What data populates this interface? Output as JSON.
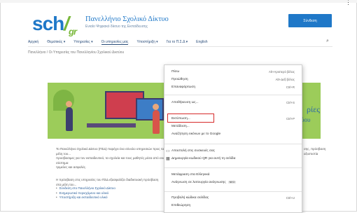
{
  "header": {
    "logo_main": "sch",
    "logo_slash": "/",
    "logo_gr": "gr",
    "title": "Πανελλήνιο Σχολικό Δίκτυο",
    "subtitle": "Ενιαίο Ψηφιακό δίκτυο της Εκπαίδευσης",
    "button_label": "Σύνδεση",
    "more_icon": "⋮"
  },
  "nav": {
    "items": [
      "Αρχική",
      "Θεματικές ▾",
      "Υπηρεσίες ▾",
      "Οι υπηρεσίες μας",
      "Υποστήριξη ▾",
      "Για το Π.Σ.Δ ▾",
      "English"
    ],
    "search_icon": "⌕"
  },
  "breadcrumb": "Πανελλήνιο / Οι Υπηρεσίες του Πανελληνίου Σχολικού Δικτύου",
  "hero": {
    "text_line1": "ρίες",
    "text_line2": "ύου"
  },
  "content": {
    "para1_line1": "Το Πανελλήνιο Σχολικό Δίκτυο (ΠΣΔ) παρέχει ένα σύνολο υπηρεσιών προς τα μέλη του...",
    "para1_line2": "προσβασιμες για τον εκπαιδευτικό, τα σχολεία και τους μαθητές μέσα από ενιαίο σύστημα",
    "para1_line3": "τριμελες και ασφαλές.",
    "para1_right1": "σης, πρόσβαση",
    "para1_right2": "αξιοπιστία",
    "para2": "Η πρόσβαση στις υπηρεσίες του ΠΣΔ εξασφαλίζει διαδικτυακή πρόσβαση στα μέλη του...",
    "list": [
      "Σύνδεση στο Πανελλήνιο Σχολικό Δίκτυο",
      "Ενημερωτικό περιεχόμενο και υλικό",
      "Υποστήριξη και εκπαιδευτικό υλικό"
    ]
  },
  "context_menu": {
    "items": [
      {
        "label": "Πίσω",
        "shortcut": "Alt+Αριστερό βέλος"
      },
      {
        "label": "Προώθηση",
        "shortcut": "Alt+Δεξί βέλος"
      },
      {
        "label": "Επαναφόρτωση",
        "shortcut": "Ctrl+R"
      },
      {
        "label": "Αποθήκευση ως...",
        "shortcut": "Ctrl+S"
      },
      {
        "label": "Εκτύπωση...",
        "shortcut": "Ctrl+P"
      },
      {
        "label": "Μετάδοση...",
        "shortcut": ""
      },
      {
        "label": "Αναζήτηση εικόνων με το Google",
        "shortcut": ""
      },
      {
        "label": "Αποστολή στις συσκευές σας",
        "shortcut": ""
      },
      {
        "label": "Δημιουργία κωδικού QR για αυτή τη σελίδα",
        "shortcut": ""
      },
      {
        "label": "Μετάφραση στα Ελληνικά",
        "shortcut": ""
      },
      {
        "label": "Ανάγνωση σε λειτουργία ανάγνωσης",
        "shortcut": "",
        "tag": "ΝΕΟ"
      },
      {
        "label": "Προβολή κώδικα σελίδας",
        "shortcut": "Ctrl+U"
      },
      {
        "label": "Επιθεώρηση",
        "shortcut": ""
      }
    ],
    "highlighted_item": "Εκτύπωση...",
    "highlight_color": "#d62b2b"
  },
  "colors": {
    "brand_blue": "#1f78c8",
    "brand_green": "#79b83a",
    "hero_green": "#9ccc5a"
  }
}
